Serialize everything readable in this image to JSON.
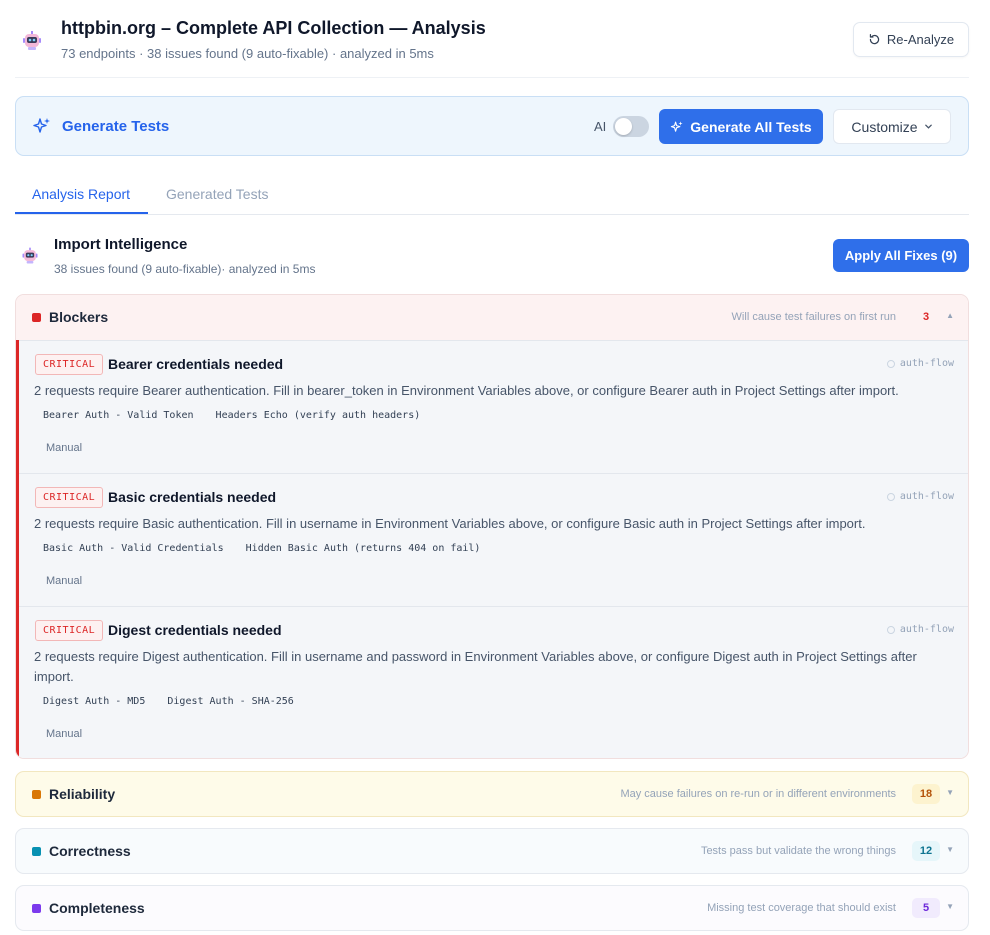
{
  "header": {
    "title": "httpbin.org – Complete API Collection — Analysis",
    "subtitle": "73 endpoints · 38 issues found (9 auto-fixable) · analyzed in 5ms",
    "reanalyze_label": "Re-Analyze"
  },
  "generate": {
    "label": "Generate Tests",
    "ai_label": "AI",
    "ai_enabled": false,
    "generate_all_label": "Generate All Tests",
    "customize_label": "Customize"
  },
  "tabs": [
    {
      "label": "Analysis Report",
      "active": true
    },
    {
      "label": "Generated Tests",
      "active": false
    }
  ],
  "intelligence": {
    "title": "Import Intelligence",
    "subtitle": "38 issues found (9 auto-fixable)· analyzed in 5ms",
    "apply_all_label": "Apply All Fixes (9)"
  },
  "sections": {
    "blockers": {
      "name": "Blockers",
      "description": "Will cause test failures on first run",
      "count": "3",
      "color": "#dc2626",
      "issues": [
        {
          "severity": "CRITICAL",
          "title": "Bearer credentials needed",
          "tag": "auth-flow",
          "description": "2 requests require Bearer authentication. Fill in bearer_token in Environment Variables above, or configure Bearer auth in Project Settings after import.",
          "requests": [
            "Bearer Auth - Valid Token",
            "Headers Echo (verify auth headers)"
          ],
          "mode": "Manual"
        },
        {
          "severity": "CRITICAL",
          "title": "Basic credentials needed",
          "tag": "auth-flow",
          "description": "2 requests require Basic authentication. Fill in username in Environment Variables above, or configure Basic auth in Project Settings after import.",
          "requests": [
            "Basic Auth - Valid Credentials",
            "Hidden Basic Auth (returns 404 on fail)"
          ],
          "mode": "Manual"
        },
        {
          "severity": "CRITICAL",
          "title": "Digest credentials needed",
          "tag": "auth-flow",
          "description": "2 requests require Digest authentication. Fill in username and password in Environment Variables above, or configure Digest auth in Project Settings after import.",
          "requests": [
            "Digest Auth - MD5",
            "Digest Auth - SHA-256"
          ],
          "mode": "Manual"
        }
      ]
    },
    "reliability": {
      "name": "Reliability",
      "description": "May cause failures on re-run or in different environments",
      "count": "18",
      "color": "#d97706"
    },
    "correctness": {
      "name": "Correctness",
      "description": "Tests pass but validate the wrong things",
      "count": "12",
      "color": "#0891b2"
    },
    "completeness": {
      "name": "Completeness",
      "description": "Missing test coverage that should exist",
      "count": "5",
      "color": "#7c3aed"
    }
  }
}
